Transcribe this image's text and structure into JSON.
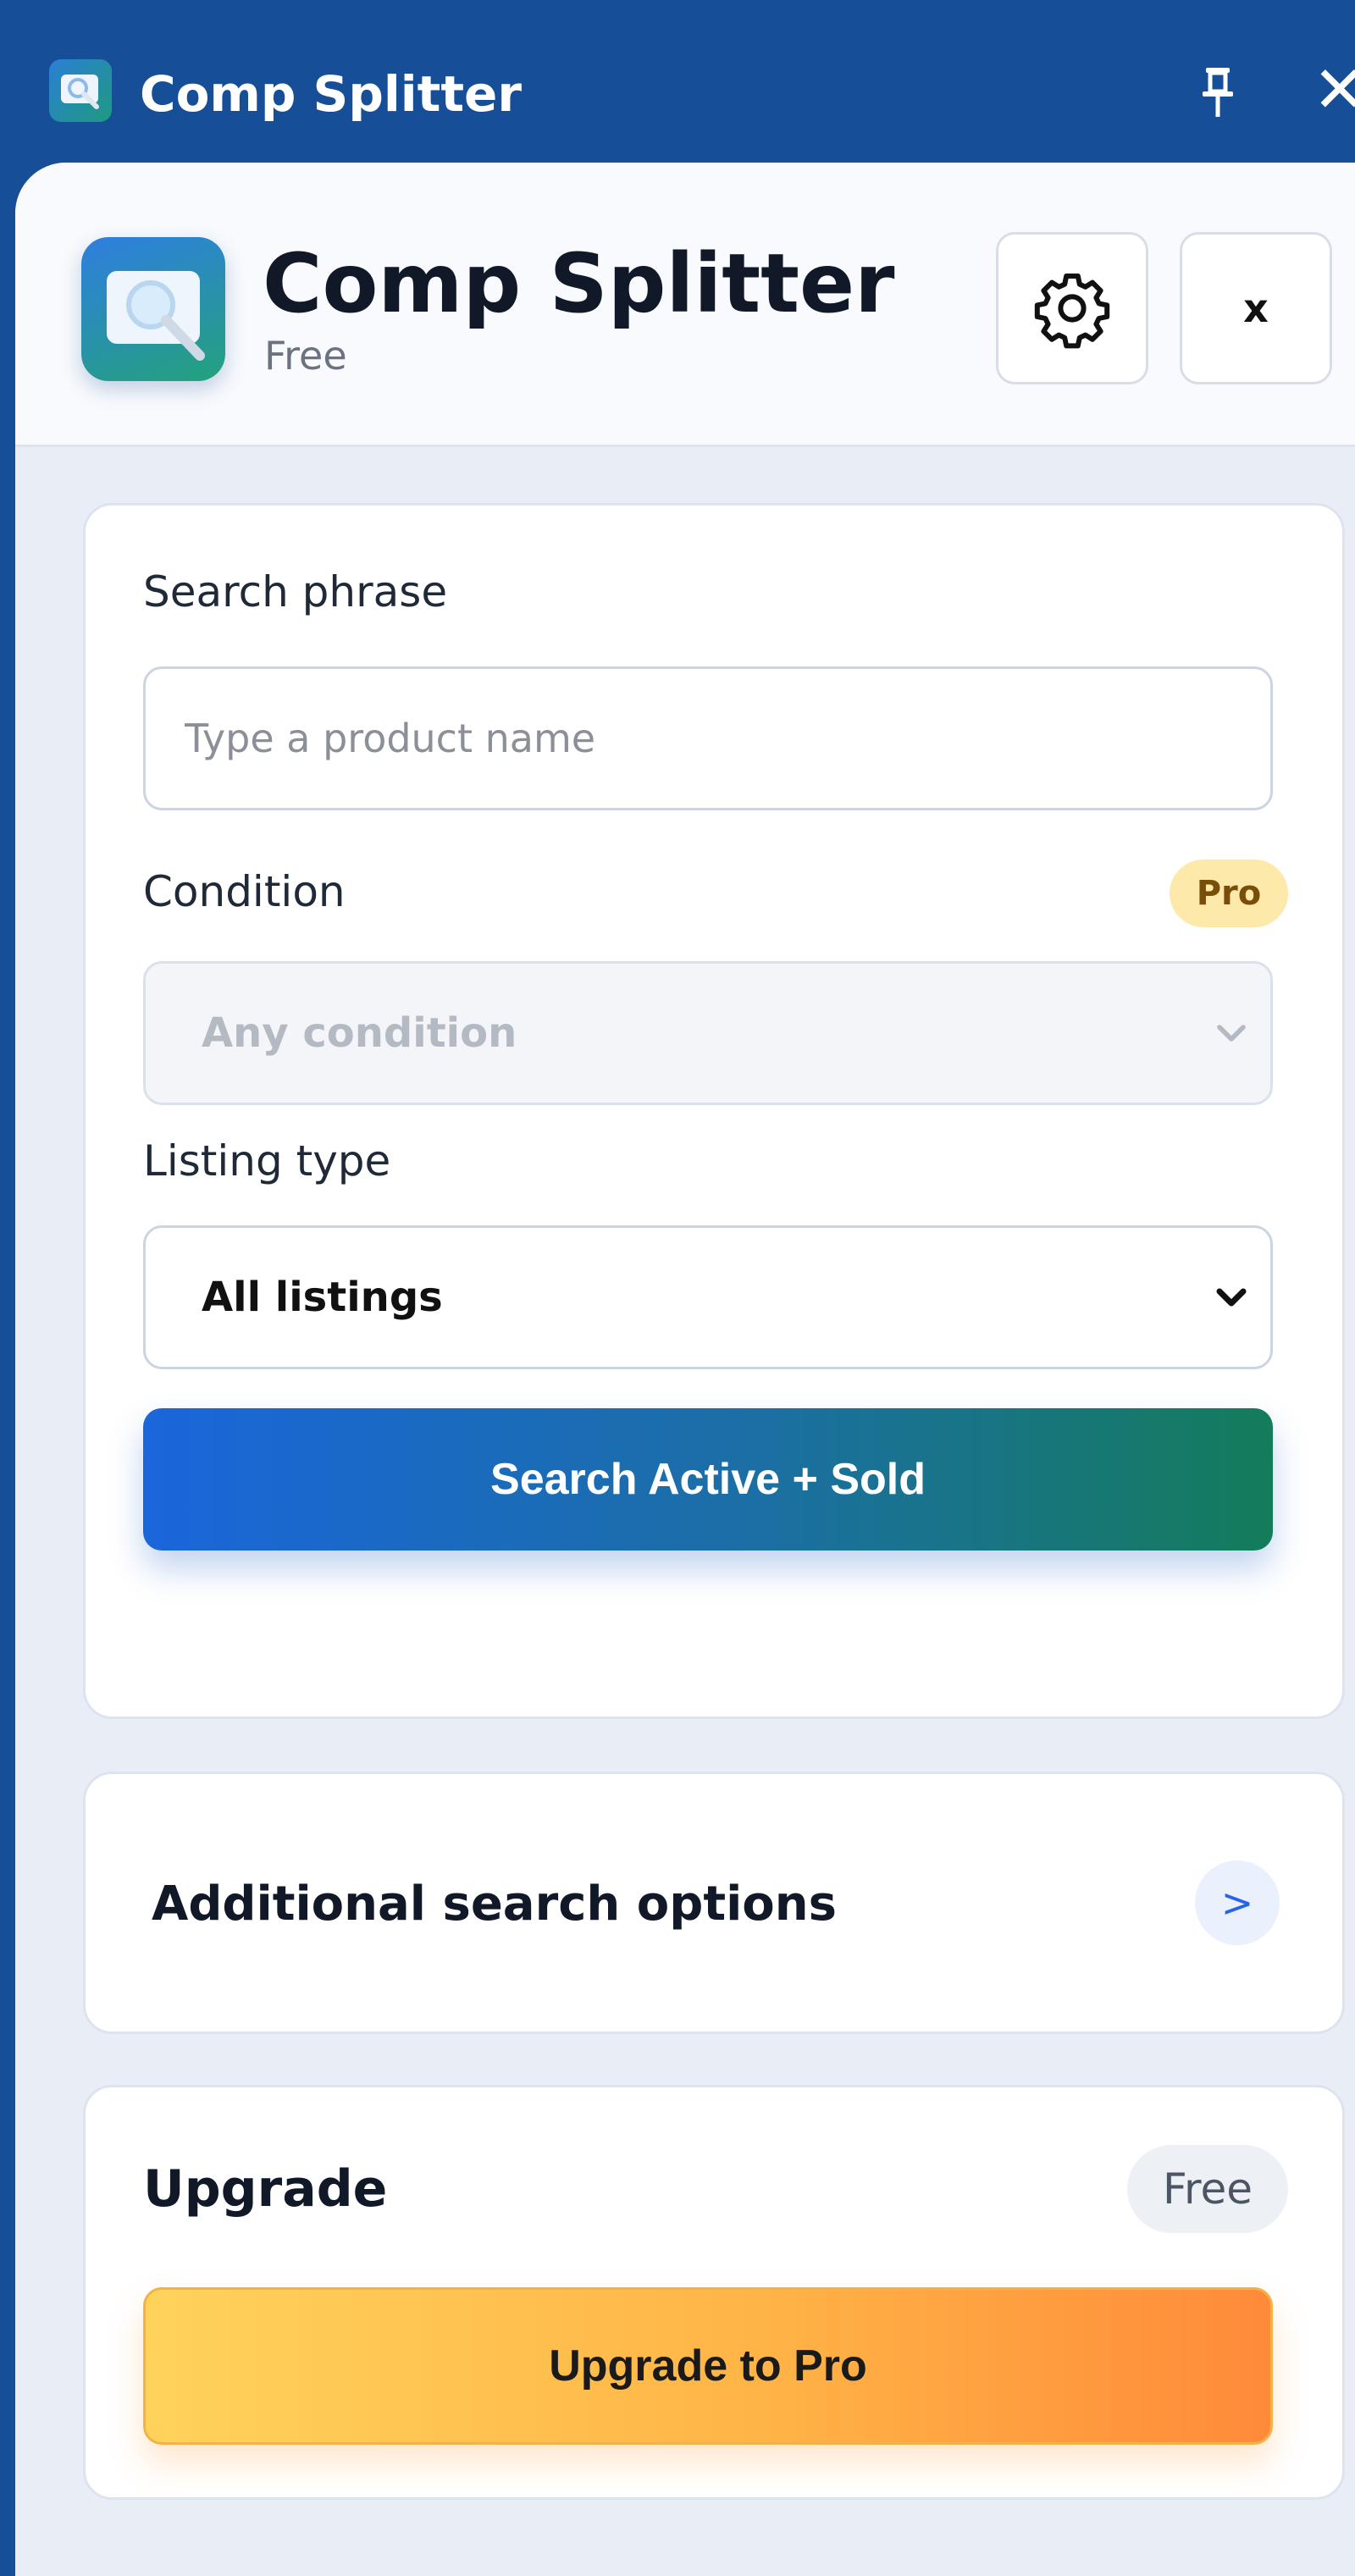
{
  "window": {
    "title": "Comp Splitter",
    "pin_icon": "pin-icon",
    "close_glyph": "✕"
  },
  "header": {
    "app_name": "Comp Splitter",
    "plan": "Free",
    "settings_icon": "gear-icon",
    "close_label": "x"
  },
  "search": {
    "phrase_label": "Search phrase",
    "phrase_placeholder": "Type a product name",
    "phrase_value": "",
    "condition_label": "Condition",
    "condition_badge": "Pro",
    "condition_value": "Any condition",
    "listing_type_label": "Listing type",
    "listing_type_value": "All listings",
    "search_button": "Search Active + Sold"
  },
  "additional": {
    "label": "Additional search options",
    "arrow": ">"
  },
  "upgrade": {
    "title": "Upgrade",
    "plan_badge": "Free",
    "button": "Upgrade to Pro"
  },
  "colors": {
    "titlebar": "#164f98",
    "primary_gradient_start": "#1a66db",
    "primary_gradient_end": "#147c5a",
    "upgrade_gradient_start": "#ffd35a",
    "upgrade_gradient_end": "#ff8a3a",
    "pro_badge_bg": "#fde9a9"
  }
}
